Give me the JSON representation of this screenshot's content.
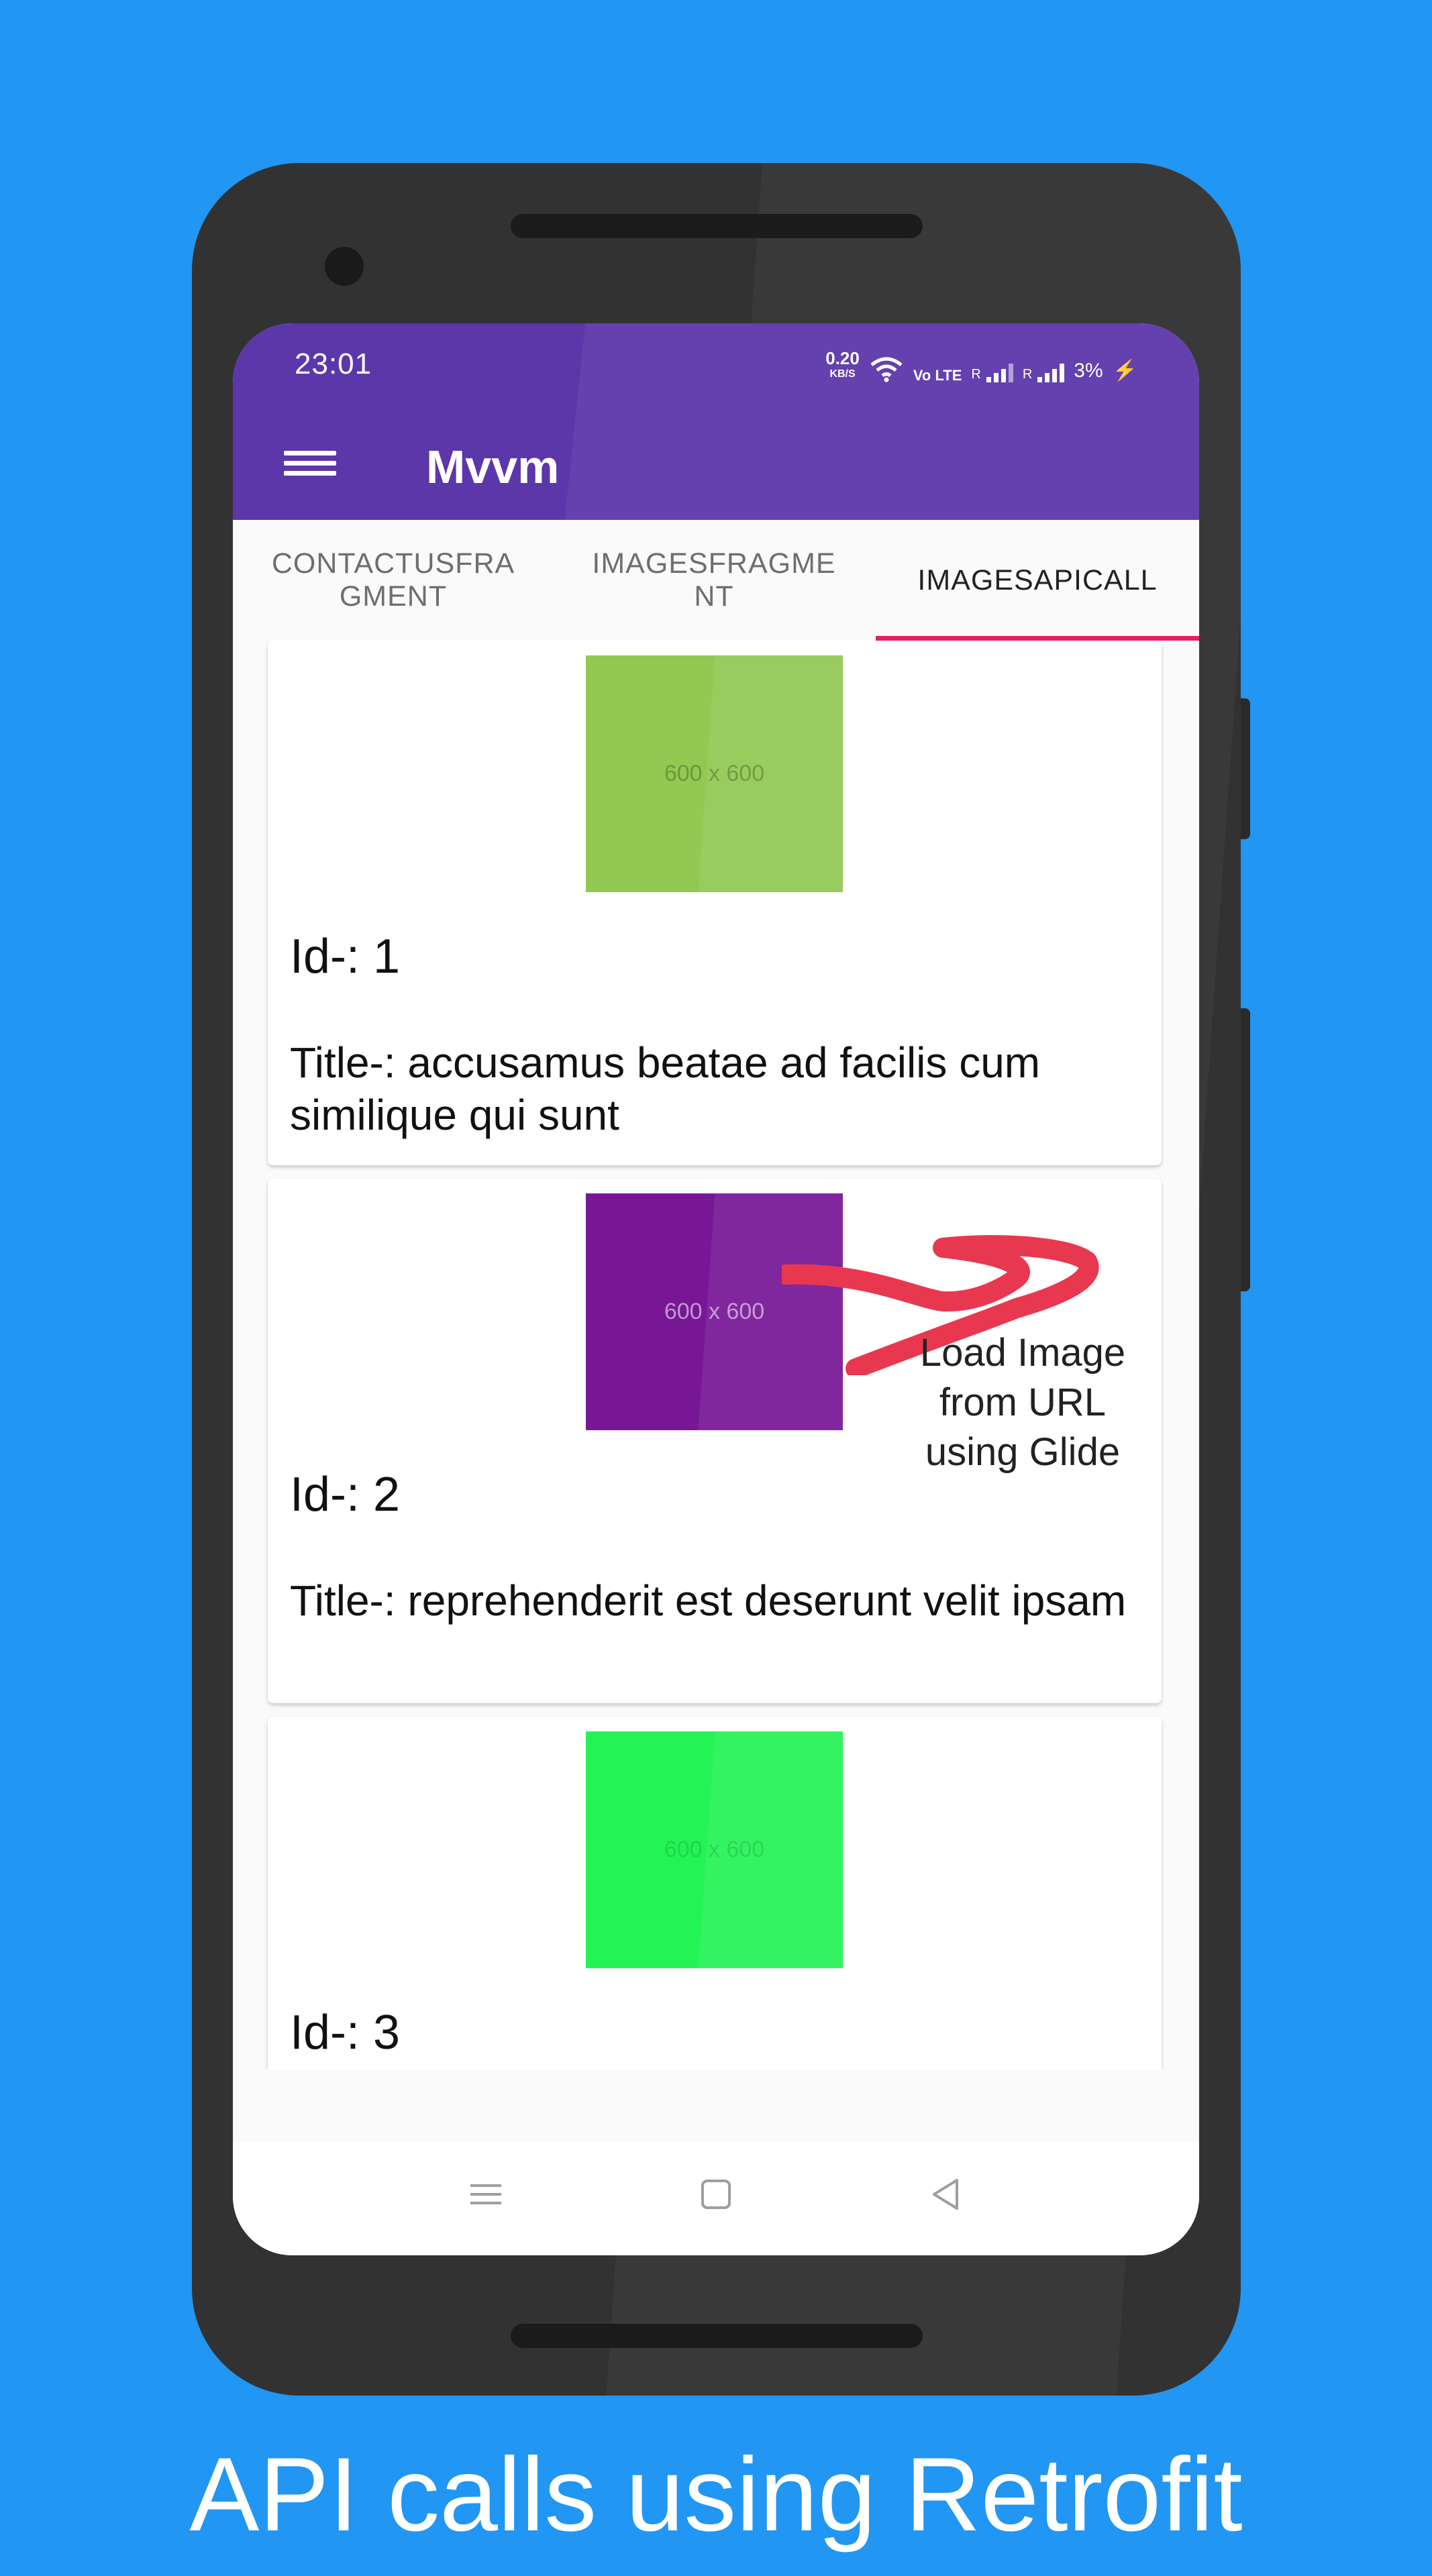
{
  "colors": {
    "background": "#2196F3",
    "primary": "#5C37AA",
    "tab_indicator": "#E91E63",
    "annotation": "#E8384F"
  },
  "status_bar": {
    "time": "23:01",
    "net_speed": "0.20",
    "net_unit": "KB/S",
    "volte": "Vo LTE",
    "signal_label": "R",
    "battery": "3%",
    "icons": [
      "wifi-icon",
      "signal-icon",
      "battery-charging-icon"
    ]
  },
  "app_bar": {
    "menu_icon": "hamburger-menu-icon",
    "title": "Mvvm"
  },
  "tabs": [
    {
      "label": "CONTACTUSFRA\nGMENT",
      "active": false
    },
    {
      "label": "IMAGESFRAGME\nNT",
      "active": false
    },
    {
      "label": "IMAGESAPICALL",
      "active": true
    }
  ],
  "list": {
    "items": [
      {
        "id_text": "Id-: 1",
        "title_text": "Title-: accusamus beatae ad facilis cum similique qui sunt",
        "image_label": "600 x 600",
        "image_color": "#92C952"
      },
      {
        "id_text": "Id-: 2",
        "title_text": "Title-: reprehenderit est deserunt velit ipsam",
        "image_label": "600 x 600",
        "image_color": "#771796"
      },
      {
        "id_text": "Id-: 3",
        "title_text": "",
        "image_label": "600 x 600",
        "image_color": "#24F355"
      }
    ]
  },
  "annotation": {
    "text": "Load Image from URL using Glide"
  },
  "nav_bar": {
    "icons": [
      "recents-menu-icon",
      "home-square-icon",
      "back-triangle-icon"
    ]
  },
  "caption": "API calls using Retrofit"
}
